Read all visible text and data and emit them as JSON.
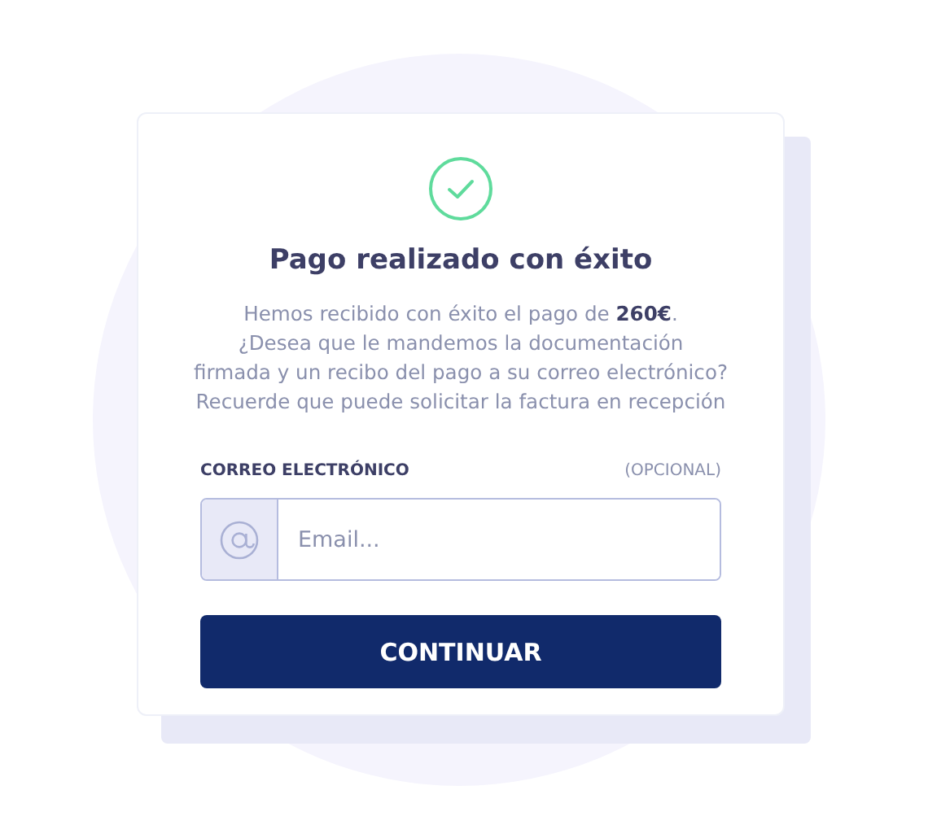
{
  "title": "Pago realizado con éxito",
  "message": "Hemos recibido con éxito el pago de **260€**.\n¿Desea que le mandemos la documentación\nfirmada y un recibo del pago a su correo electrónico?\nRecuerde que puede solicitar la factura en recepción",
  "email_field": {
    "label": "CORREO ELECTRÓNICO",
    "hint": "(OPCIONAL)",
    "placeholder": "Email..."
  },
  "button": "CONTINUAR"
}
